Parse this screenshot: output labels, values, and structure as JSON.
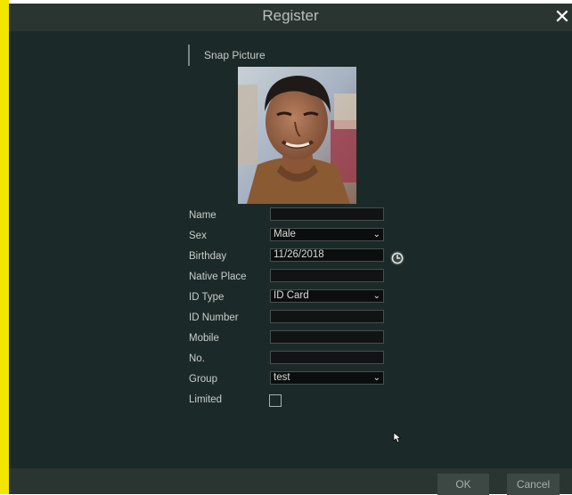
{
  "dialog": {
    "title": "Register",
    "close_icon": "close-icon"
  },
  "snap_section": {
    "label": "Snap Picture"
  },
  "form": {
    "name": {
      "label": "Name",
      "value": ""
    },
    "sex": {
      "label": "Sex",
      "value": "Male",
      "icon": "chevron-down-icon"
    },
    "birthday": {
      "label": "Birthday",
      "value": "11/26/2018",
      "icon": "clock-icon"
    },
    "native_place": {
      "label": "Native Place",
      "value": ""
    },
    "id_type": {
      "label": "ID Type",
      "value": "ID Card",
      "icon": "chevron-down-icon"
    },
    "id_number": {
      "label": "ID Number",
      "value": ""
    },
    "mobile": {
      "label": "Mobile",
      "value": ""
    },
    "no": {
      "label": "No.",
      "value": ""
    },
    "group": {
      "label": "Group",
      "value": "test",
      "icon": "chevron-down-icon"
    },
    "limited": {
      "label": "Limited",
      "checked": false
    }
  },
  "footer": {
    "ok_label": "OK",
    "cancel_label": "Cancel"
  },
  "colors": {
    "dialog_bg": "#1b2a28",
    "titlebar_bg": "#2a3431",
    "accent_left_bar": "#f2e500",
    "field_bg": "#121314"
  }
}
